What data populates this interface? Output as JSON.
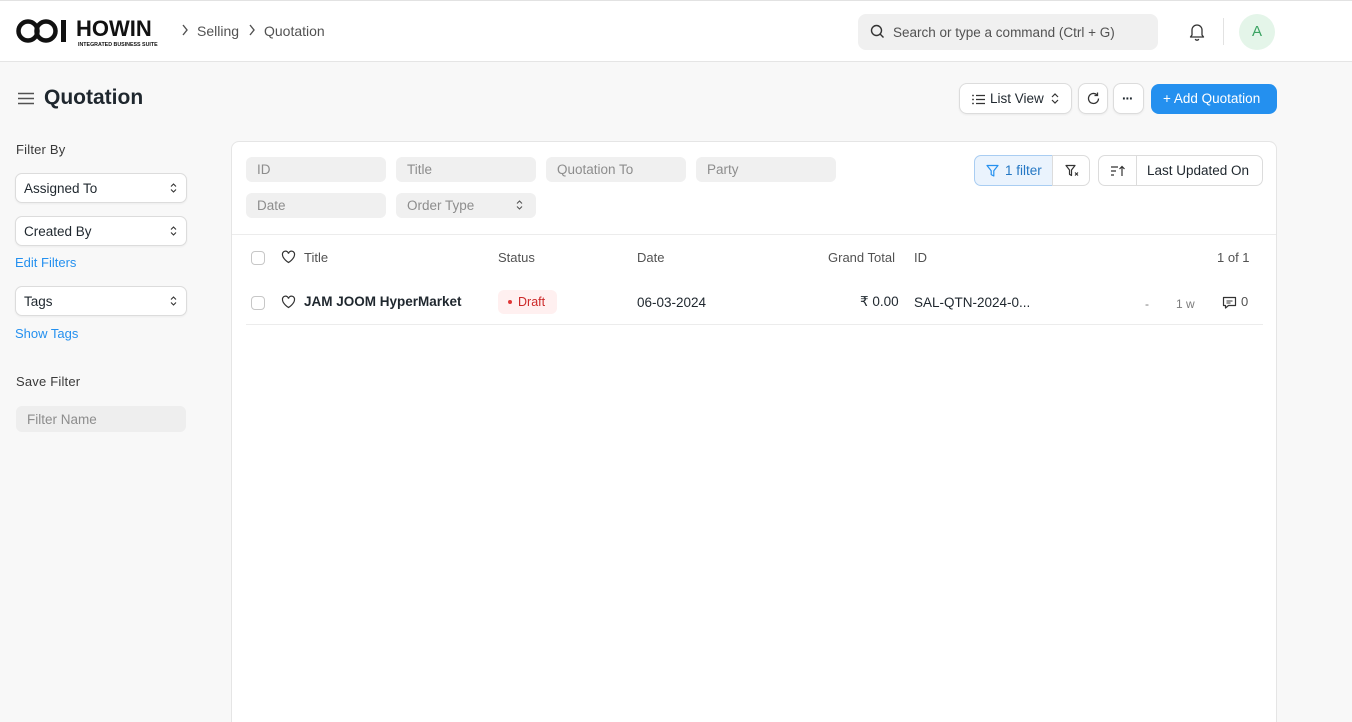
{
  "brand": {
    "name": "HOWIN",
    "tagline": "INTEGRATED BUSINESS SUITE"
  },
  "breadcrumbs": [
    "Selling",
    "Quotation"
  ],
  "search": {
    "placeholder": "Search or type a command (Ctrl + G)"
  },
  "user": {
    "avatar_letter": "A"
  },
  "page": {
    "title": "Quotation",
    "view_label": "List View",
    "more_label": "···",
    "add_label": "+ Add Quotation"
  },
  "sidebar": {
    "filter_by_label": "Filter By",
    "assigned_to": "Assigned To",
    "created_by": "Created By",
    "edit_filters": "Edit Filters",
    "tags": "Tags",
    "show_tags": "Show Tags",
    "save_filter_label": "Save Filter",
    "filter_name_placeholder": "Filter Name"
  },
  "filters": {
    "id": "ID",
    "title": "Title",
    "quotation_to": "Quotation To",
    "party": "Party",
    "date": "Date",
    "order_type": "Order Type",
    "filter_count": "1 filter",
    "sort_label": "Last Updated On"
  },
  "table": {
    "headers": {
      "title": "Title",
      "status": "Status",
      "date": "Date",
      "grand_total": "Grand Total",
      "id": "ID",
      "count": "1 of 1"
    },
    "rows": [
      {
        "title": "JAM JOOM HyperMarket",
        "status": "Draft",
        "date": "06-03-2024",
        "grand_total": "₹ 0.00",
        "id": "SAL-QTN-2024-0...",
        "assigned": "-",
        "modified": "1 w",
        "comments": "0"
      }
    ]
  },
  "colors": {
    "primary": "#2490ef",
    "draft_bg": "#fff0f0",
    "draft_text": "#cc2929",
    "avatar_bg": "#e4f5e9",
    "avatar_text": "#3aa362"
  }
}
